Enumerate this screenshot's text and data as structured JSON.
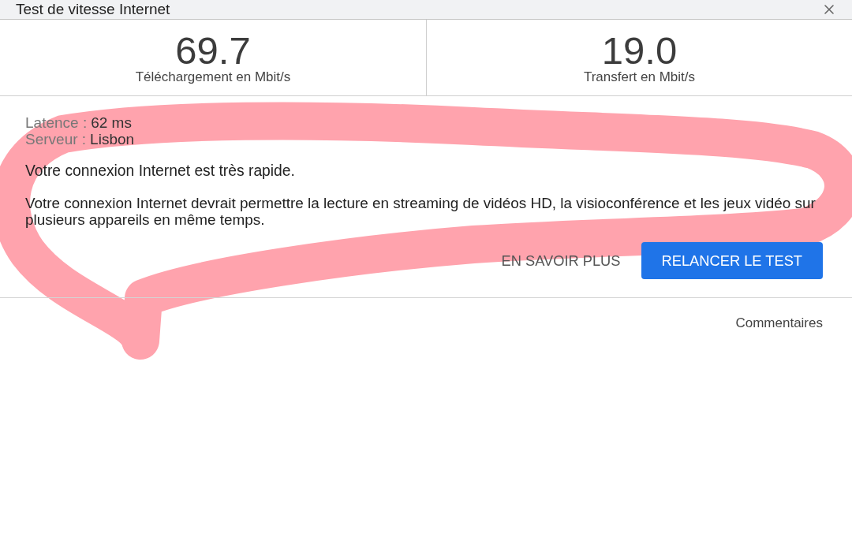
{
  "window": {
    "title": "Test de vitesse Internet"
  },
  "results": [
    {
      "value": "69.7",
      "label": "Téléchargement en Mbit/s"
    },
    {
      "value": "19.0",
      "label": "Transfert en Mbit/s"
    }
  ],
  "details": [
    {
      "label": "Latence :",
      "value": "62 ms"
    },
    {
      "label": "Serveur :",
      "value": "Lisbon"
    }
  ],
  "summary": "Votre connexion Internet est très rapide.",
  "description": "Votre connexion Internet devrait permettre la lecture en streaming de vidéos HD, la visioconférence et les jeux vidéo sur plusieurs appareils en même temps.",
  "buttons": [
    {
      "label": "EN SAVOIR PLUS",
      "kind": "text"
    },
    {
      "label": "RELANCER LE TEST",
      "kind": "primary"
    }
  ],
  "feedback_link": "Commentaires"
}
